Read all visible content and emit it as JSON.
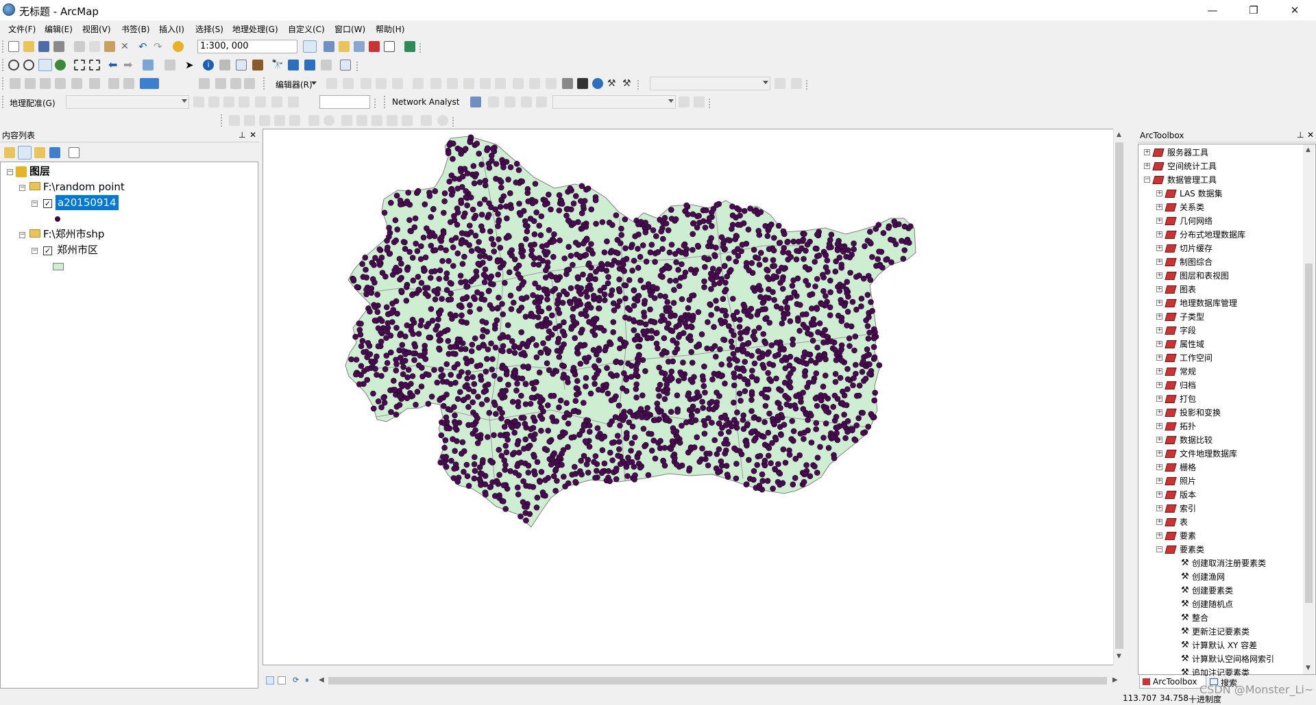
{
  "window": {
    "title": "无标题 - ArcMap",
    "minimize": "—",
    "maximize": "❐",
    "close": "✕"
  },
  "menu": [
    "文件(F)",
    "编辑(E)",
    "视图(V)",
    "书签(B)",
    "插入(I)",
    "选择(S)",
    "地理处理(G)",
    "自定义(C)",
    "窗口(W)",
    "帮助(H)"
  ],
  "toolbar": {
    "scale": "1:300, 000",
    "editor": "编辑器(R)",
    "georef": "地理配准(G)",
    "network_analyst": "Network Analyst"
  },
  "toc": {
    "title": "内容列表",
    "root": "图层",
    "groups": [
      {
        "path": "F:\\random point",
        "layer": "a20150914",
        "selected": true,
        "symbol": "point"
      },
      {
        "path": "F:\\郑州市shp",
        "layer": "郑州市区",
        "selected": false,
        "symbol": "polygon"
      }
    ]
  },
  "toolbox": {
    "title": "ArcToolbox",
    "top_items": [
      "服务器工具",
      "空间统计工具",
      "数据管理工具"
    ],
    "sub_items": [
      "LAS 数据集",
      "关系类",
      "几何网络",
      "分布式地理数据库",
      "切片缓存",
      "制图综合",
      "图层和表视图",
      "图表",
      "地理数据库管理",
      "子类型",
      "字段",
      "属性域",
      "工作空间",
      "常规",
      "归档",
      "打包",
      "投影和变换",
      "拓扑",
      "数据比较",
      "文件地理数据库",
      "栅格",
      "照片",
      "版本",
      "索引",
      "表",
      "要素",
      "要素类"
    ],
    "tools": [
      "创建取消注册要素类",
      "创建渔网",
      "创建要素类",
      "创建随机点",
      "整合",
      "更新注记要素类",
      "计算默认 XY 容差",
      "计算默认空间格网索引",
      "追加注记要素类"
    ],
    "tabs": [
      "ArcToolbox",
      "搜索"
    ]
  },
  "status": {
    "x": "113.707",
    "y": "34.758",
    "units": "十进制度",
    "watermark": "CSDN @Monster_Li~"
  },
  "colors": {
    "polygon_fill": "#cdeed1",
    "polygon_stroke": "#808080",
    "point_fill": "#4a0a52",
    "selection": "#0078d7"
  },
  "map": {
    "points": 2600
  }
}
